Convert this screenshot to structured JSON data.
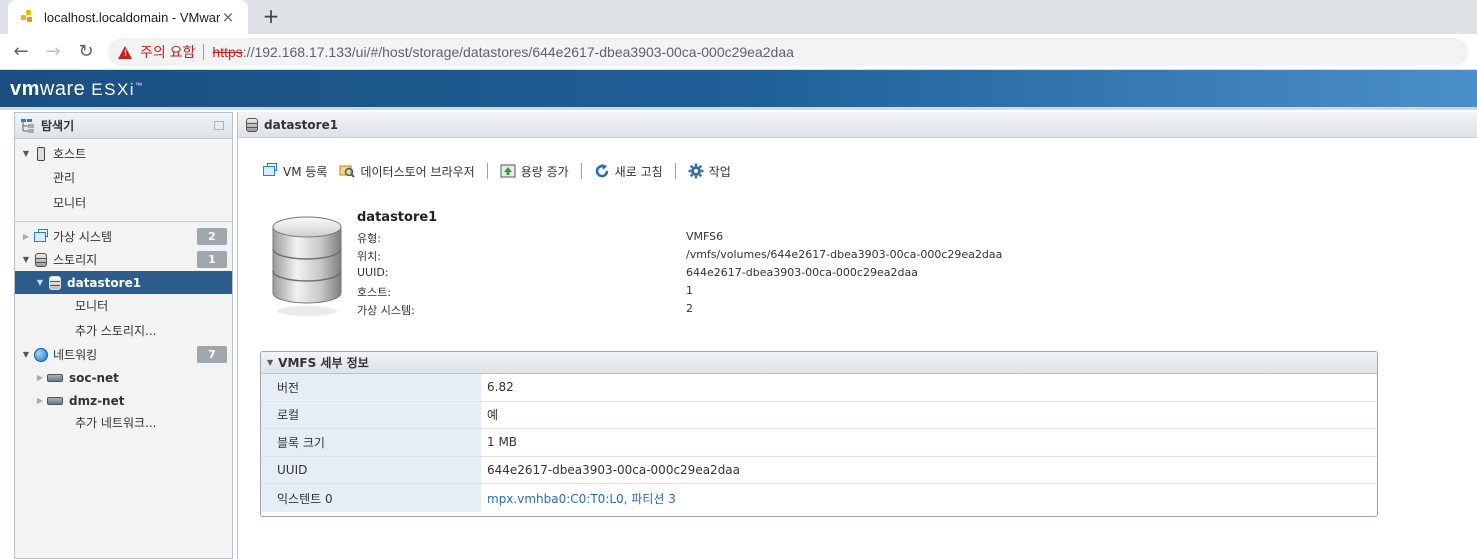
{
  "browser": {
    "tab_title": "localhost.localdomain - VMware",
    "tab_close": "×",
    "new_tab": "+",
    "security_label": "주의 요함",
    "url_scheme": "https",
    "url_rest": "://192.168.17.133/ui/#/host/storage/datastores/644e2617-dbea3903-00ca-000c29ea2daa"
  },
  "app": {
    "brand_vm": "vm",
    "brand_ware": "ware",
    "brand_product": "ESXi",
    "brand_tm": "™"
  },
  "navigator": {
    "title": "탐색기",
    "host": {
      "label": "호스트",
      "children": [
        "관리",
        "모니터"
      ]
    },
    "vms": {
      "label": "가상 시스템",
      "count": "2"
    },
    "storage": {
      "label": "스토리지",
      "count": "1"
    },
    "datastore": {
      "label": "datastore1",
      "children": [
        "모니터",
        "추가 스토리지..."
      ]
    },
    "networking": {
      "label": "네트워킹",
      "count": "7"
    },
    "networks": [
      "soc-net",
      "dmz-net"
    ],
    "more_networks": "추가 네트워크..."
  },
  "content": {
    "header_title": "datastore1",
    "toolbar": {
      "register_vm": "VM 등록",
      "browser": "데이터스토어 브라우저",
      "increase": "용량 증가",
      "refresh": "새로 고침",
      "actions": "작업"
    },
    "summary": {
      "name": "datastore1",
      "rows": [
        {
          "label": "유형:",
          "value": "VMFS6"
        },
        {
          "label": "위치:",
          "value": "/vmfs/volumes/644e2617-dbea3903-00ca-000c29ea2daa"
        },
        {
          "label": "UUID:",
          "value": "644e2617-dbea3903-00ca-000c29ea2daa"
        },
        {
          "label": "호스트:",
          "value": "1"
        },
        {
          "label": "가상 시스템:",
          "value": "2"
        }
      ]
    },
    "vmfs_panel": {
      "title": "VMFS 세부 정보",
      "rows": [
        {
          "label": "버전",
          "value": "6.82"
        },
        {
          "label": "로컬",
          "value": "예"
        },
        {
          "label": "블록 크기",
          "value": "1 MB"
        },
        {
          "label": "UUID",
          "value": "644e2617-dbea3903-00ca-000c29ea2daa"
        },
        {
          "label": "익스텐트 0",
          "value": "mpx.vmhba0:C0:T0:L0, 파티션 3"
        }
      ]
    }
  },
  "colors": {
    "header_gradient_start": "#1a4f80",
    "header_gradient_end": "#4b8fca",
    "selected_nav": "#2d5d8d",
    "badge": "#9fa6ad",
    "link": "#2a6bb0",
    "warning": "#c5221f"
  }
}
